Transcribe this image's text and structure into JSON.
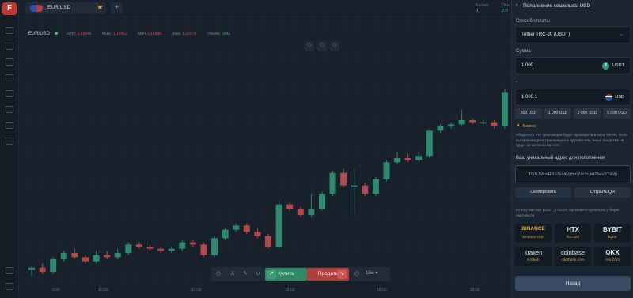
{
  "app": {
    "logo_letter": "F",
    "pair": "EUR/USD",
    "add_tab": "+",
    "balance_label": "Баланс",
    "balance_value": "0",
    "profit_label": "Опы",
    "profit_value": "0.0"
  },
  "chart": {
    "symbol": "EUR/USD",
    "ohlc": [
      {
        "key": "Откр",
        "value": "1.15941"
      },
      {
        "key": "Макс",
        "value": "1.15952"
      },
      {
        "key": "Мин",
        "value": "1.15930"
      },
      {
        "key": "Закр",
        "value": "1.15078"
      },
      {
        "key": "Объем",
        "value": "1043"
      }
    ],
    "colors": {
      "up": "#2e8a6f",
      "down": "#b54848",
      "grid": "#1f2a36"
    },
    "time_labels": [
      "9:00",
      "10:00",
      "12:00",
      "15:00",
      "16:00",
      "18:00"
    ]
  },
  "chart_data": {
    "type": "candlestick",
    "candles": [
      [
        4,
        5,
        1,
        6
      ],
      [
        5,
        3,
        2,
        7
      ],
      [
        3,
        9,
        2,
        10
      ],
      [
        9,
        12,
        8,
        13
      ],
      [
        12,
        10,
        9,
        14
      ],
      [
        10,
        8,
        7,
        11
      ],
      [
        8,
        11,
        7,
        13
      ],
      [
        11,
        10,
        9,
        13
      ],
      [
        10,
        12,
        9,
        14
      ],
      [
        12,
        16,
        11,
        17
      ],
      [
        16,
        15,
        14,
        17
      ],
      [
        15,
        14,
        13,
        16
      ],
      [
        14,
        13,
        12,
        15
      ],
      [
        13,
        14,
        12,
        15
      ],
      [
        14,
        17,
        13,
        18
      ],
      [
        17,
        16,
        15,
        18
      ],
      [
        16,
        11,
        10,
        17
      ],
      [
        11,
        19,
        10,
        20
      ],
      [
        19,
        23,
        18,
        24
      ],
      [
        23,
        25,
        22,
        26
      ],
      [
        25,
        22,
        21,
        26
      ],
      [
        22,
        20,
        19,
        24
      ],
      [
        20,
        15,
        14,
        21
      ],
      [
        15,
        35,
        14,
        37
      ],
      [
        35,
        33,
        32,
        36
      ],
      [
        33,
        30,
        29,
        34
      ],
      [
        30,
        33,
        29,
        40
      ],
      [
        33,
        40,
        32,
        41
      ],
      [
        40,
        50,
        39,
        51
      ],
      [
        50,
        44,
        43,
        52
      ],
      [
        44,
        44,
        30,
        52
      ],
      [
        44,
        40,
        39,
        45
      ],
      [
        40,
        47,
        39,
        48
      ],
      [
        47,
        55,
        46,
        56
      ],
      [
        55,
        57,
        54,
        60
      ],
      [
        57,
        56,
        55,
        59
      ],
      [
        56,
        58,
        55,
        60
      ],
      [
        58,
        70,
        57,
        71
      ],
      [
        70,
        72,
        69,
        73
      ],
      [
        72,
        73,
        71,
        74
      ],
      [
        73,
        75,
        72,
        80
      ],
      [
        75,
        74,
        73,
        76
      ],
      [
        74,
        74,
        73,
        75
      ],
      [
        74,
        72,
        71,
        75
      ],
      [
        72,
        88,
        71,
        90
      ]
    ]
  },
  "toolbar": {
    "buy_label": "Купить",
    "sell_label": "Продать",
    "timeframe": "15м"
  },
  "panel": {
    "title": "Пополнение кошелька: USD",
    "method_label": "Способ оплаты",
    "method_value": "Tether TRC-20 (USDT)",
    "amount_label": "Сумма",
    "amount_value": "1 000",
    "amount_currency": "USDT",
    "converted_label": "-",
    "converted_value": "1 000.1",
    "converted_currency": "USD",
    "chips": [
      "500 USD",
      "1 000 USD",
      "2 000 USD",
      "5 000 USD"
    ],
    "warning_title": "Важно",
    "warning_text": "Убедитесь что транзакция будет проведена в сети TRON. Если вы произведете транзакцию в другой сети, ваши средства не будут зачислены на счет.",
    "address_label": "Ваш уникальный адрес для пополнения",
    "address_value": "TGNJMucHRb7bs4Vg5mYdr3cpH25euYTdVp",
    "copy_button": "Скопировать",
    "qr_button": "Открыть QR",
    "buy_hint": "Если у вас нет USDT_TRC20, вы можете купить их у бирж-партнеров",
    "exchanges": [
      {
        "name": "BINANCE",
        "link": "binance.com"
      },
      {
        "name": "HTX",
        "link": "htx.com"
      },
      {
        "name": "BYBIT",
        "link": "Bybit"
      },
      {
        "name": "kraken",
        "link": "Kraken"
      },
      {
        "name": "coinbase",
        "link": "coinbase.com"
      },
      {
        "name": "OKX",
        "link": "okx.com"
      }
    ],
    "next_button": "Назад"
  }
}
